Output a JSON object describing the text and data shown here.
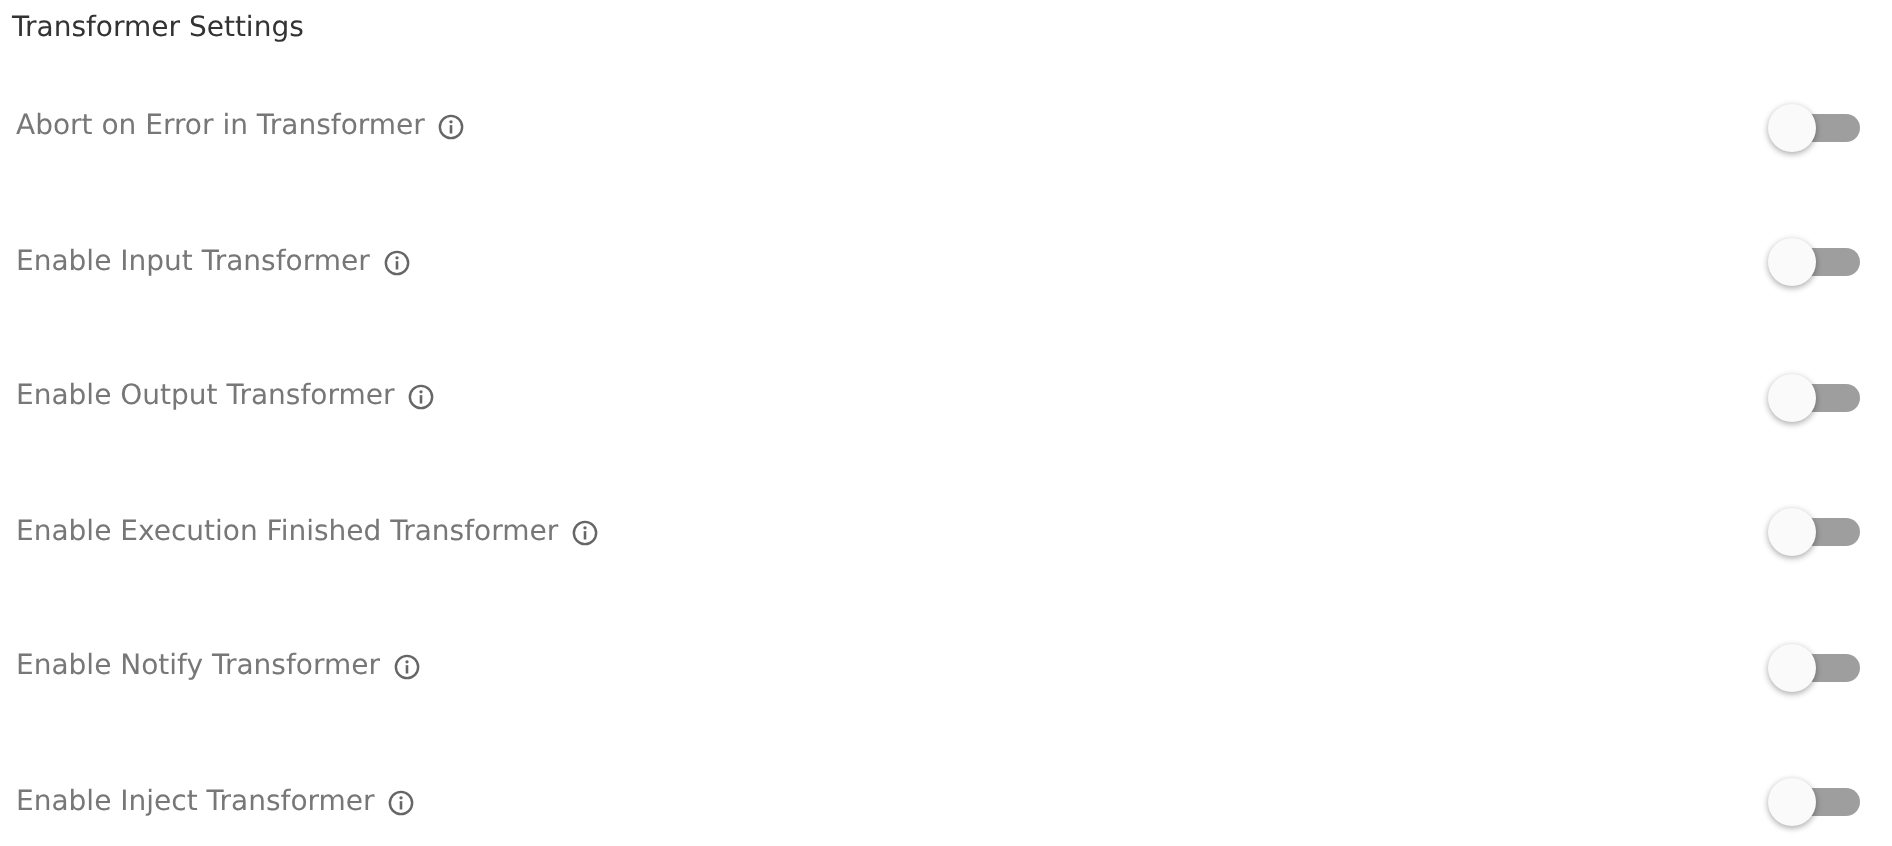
{
  "title": "Transformer Settings",
  "settings": [
    {
      "label": "Abort on Error in Transformer",
      "on": false
    },
    {
      "label": "Enable Input Transformer",
      "on": false
    },
    {
      "label": "Enable Output Transformer",
      "on": false
    },
    {
      "label": "Enable Execution Finished Transformer",
      "on": false
    },
    {
      "label": "Enable Notify Transformer",
      "on": false
    },
    {
      "label": "Enable Inject Transformer",
      "on": false
    }
  ]
}
